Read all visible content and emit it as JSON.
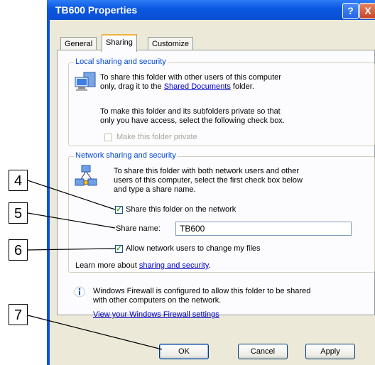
{
  "window": {
    "title": "TB600 Properties",
    "help_glyph": "?",
    "close_glyph": "X"
  },
  "tabs": [
    {
      "label": "General",
      "selected": false
    },
    {
      "label": "Sharing",
      "selected": true
    },
    {
      "label": "Customize",
      "selected": false
    }
  ],
  "local": {
    "legend": "Local sharing and security",
    "line1": "To share this folder with other users of this computer",
    "line2_prefix": "only, drag it to the ",
    "line2_link": "Shared Documents",
    "line2_suffix": " folder.",
    "line3": "To make this folder and its subfolders private so that",
    "line4": "only you have access, select the following check box.",
    "private_label": "Make this folder private",
    "private_checked": false
  },
  "network": {
    "legend": "Network sharing and security",
    "line1": "To share this folder with both network users and other",
    "line2": "users of this computer, select the first check box below",
    "line3": "and type a share name.",
    "share_label": "Share this folder on the network",
    "share_checked": true,
    "share_name_label": "Share name:",
    "share_name_value": "TB600",
    "allow_label": "Allow network users to change my files",
    "allow_checked": true,
    "learn_prefix": "Learn more about ",
    "learn_link": "sharing and security",
    "learn_suffix": "."
  },
  "firewall": {
    "line1": "Windows Firewall is configured to allow this folder to be shared",
    "line2": "with other computers on the network.",
    "link": "View your Windows Firewall settings"
  },
  "buttons": {
    "ok": "OK",
    "cancel": "Cancel",
    "apply": "Apply"
  },
  "callouts": [
    "4",
    "5",
    "6",
    "7"
  ]
}
